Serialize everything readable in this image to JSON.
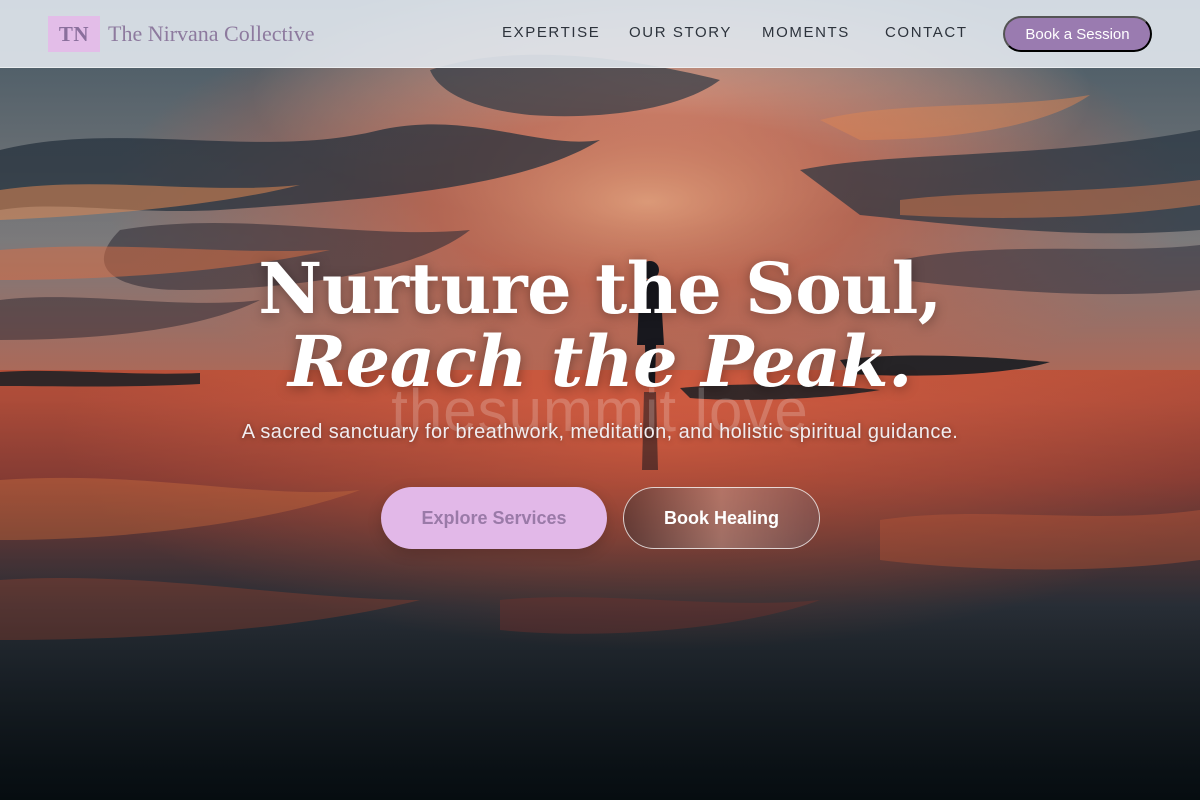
{
  "brand": {
    "mark": "TN",
    "name": "The Nirvana Collective"
  },
  "nav": {
    "items": [
      {
        "label": "EXPERTISE"
      },
      {
        "label": "OUR STORY"
      },
      {
        "label": "MOMENTS"
      },
      {
        "label": "CONTACT"
      }
    ],
    "cta_label": "Book a Session"
  },
  "hero": {
    "headline_line1": "Nurture the Soul,",
    "headline_line2": "Reach the Peak.",
    "ghost_text": "thesummit love",
    "tagline": "A sacred sanctuary for breathwork, meditation, and holistic spiritual guidance.",
    "primary_button": "Explore Services",
    "secondary_button": "Book Healing",
    "background_image": "sunset-silhouette-over-reflective-shoreline"
  },
  "colors": {
    "accent": "#9a7bb0",
    "brand_mark_bg": "#e3bde8",
    "primary_button_bg": "#e2b8e8",
    "primary_button_text": "#9a7aa8",
    "nav_text": "#2d333c"
  }
}
